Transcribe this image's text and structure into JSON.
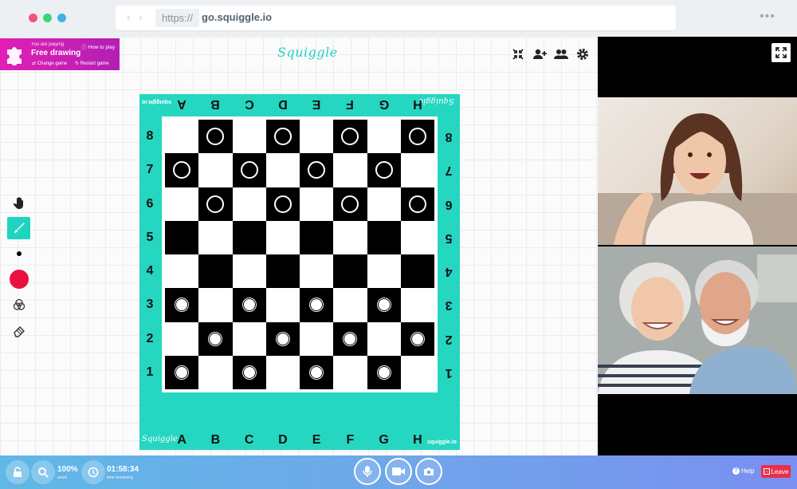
{
  "browser": {
    "protocol": "https://",
    "url": "go.squiggle.io",
    "back_icon": "chevron-left-icon",
    "forward_icon": "chevron-right-icon",
    "menu_icon": "more-horizontal-icon"
  },
  "game_banner": {
    "playing_label": "You are playing",
    "game_name": "Free drawing",
    "how_to_play": "How to play",
    "change_game": "Change game",
    "restart_game": "Restart game",
    "color": "#d21fb4"
  },
  "app": {
    "logo": "Squiggle",
    "logo_color": "#20d3c0"
  },
  "top_tools": [
    "collapse-icon",
    "add-user-icon",
    "users-icon",
    "gear-icon"
  ],
  "left_toolbar": [
    {
      "icon": "hand-icon",
      "active": false
    },
    {
      "icon": "brush-icon",
      "active": true
    },
    {
      "icon": "brush-size-icon",
      "active": false
    },
    {
      "icon": "color-swatch-icon",
      "active": false,
      "color": "#e8113f"
    },
    {
      "icon": "blend-icon",
      "active": false
    },
    {
      "icon": "eraser-icon",
      "active": false
    }
  ],
  "board": {
    "frame_color": "#25d6c1",
    "files": [
      "A",
      "B",
      "C",
      "D",
      "E",
      "F",
      "G",
      "H"
    ],
    "ranks": [
      "8",
      "7",
      "6",
      "5",
      "4",
      "3",
      "2",
      "1"
    ],
    "frame_logo": "Squiggle",
    "frame_url": "squiggle.io",
    "black_pieces": [
      "B8",
      "D8",
      "F8",
      "H8",
      "A7",
      "C7",
      "E7",
      "G7",
      "B6",
      "D6",
      "F6",
      "H6"
    ],
    "white_pieces": [
      "A3",
      "C3",
      "E3",
      "G3",
      "B2",
      "D2",
      "F2",
      "H2",
      "A1",
      "C1",
      "E1",
      "G1"
    ]
  },
  "video_panel": {
    "fullscreen_icon": "expand-icon"
  },
  "bottom_bar": {
    "zoom_value": "100%",
    "zoom_label": "zoom",
    "time_value": "01:58:34",
    "time_label": "time remaining",
    "help": "Help",
    "leave": "Leave"
  }
}
